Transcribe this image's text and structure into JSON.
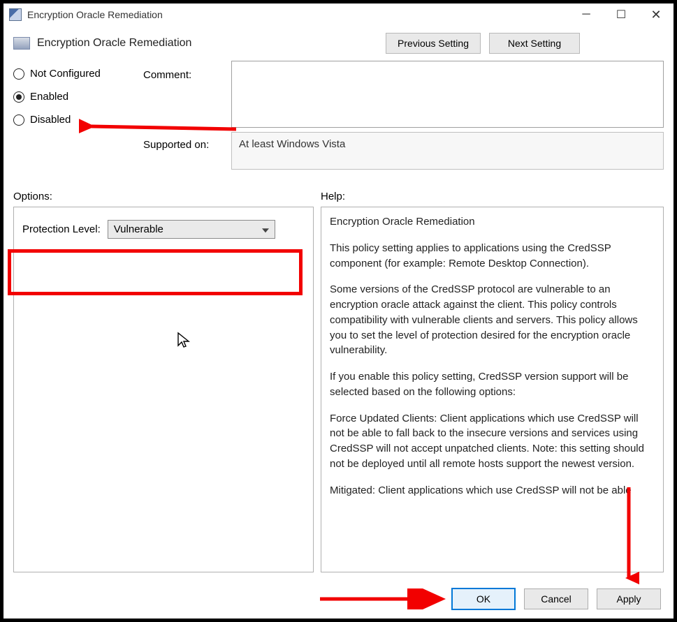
{
  "window": {
    "title": "Encryption Oracle Remediation"
  },
  "header": {
    "title": "Encryption Oracle Remediation",
    "previous": "Previous Setting",
    "next": "Next Setting"
  },
  "state": {
    "radios": {
      "not_configured": "Not Configured",
      "enabled": "Enabled",
      "disabled": "Disabled",
      "selected": "enabled"
    },
    "comment_label": "Comment:",
    "comment_value": "",
    "supported_label": "Supported on:",
    "supported_value": "At least Windows Vista"
  },
  "sections": {
    "options": "Options:",
    "help": "Help:"
  },
  "options": {
    "protection_label": "Protection Level:",
    "protection_value": "Vulnerable"
  },
  "help": {
    "p1": "Encryption Oracle Remediation",
    "p2": "This policy setting applies to applications using the CredSSP component (for example: Remote Desktop Connection).",
    "p3": "Some versions of the CredSSP protocol are vulnerable to an encryption oracle attack against the client.  This policy controls compatibility with vulnerable clients and servers.  This policy allows you to set the level of protection desired for the encryption oracle vulnerability.",
    "p4": "If you enable this policy setting, CredSSP version support will be selected based on the following options:",
    "p5": "Force Updated Clients: Client applications which use CredSSP will not be able to fall back to the insecure versions and services using CredSSP will not accept unpatched clients. Note: this setting should not be deployed until all remote hosts support the newest version.",
    "p6": "Mitigated: Client applications which use CredSSP will not be able"
  },
  "buttons": {
    "ok": "OK",
    "cancel": "Cancel",
    "apply": "Apply"
  }
}
